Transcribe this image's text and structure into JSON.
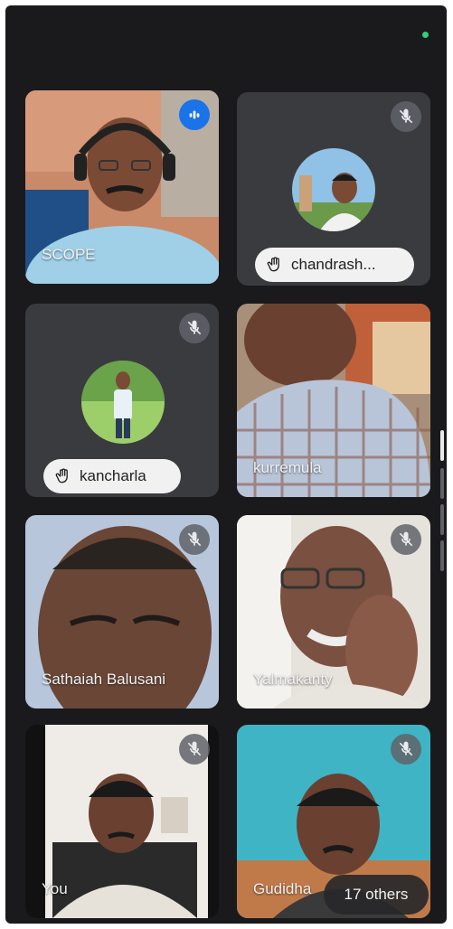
{
  "participants": [
    {
      "name": "SCOPE",
      "muted": false,
      "speaking": true
    },
    {
      "name": "chandrash...",
      "muted": true,
      "hand_raised": true
    },
    {
      "name": "kancharla",
      "muted": true,
      "hand_raised": true
    },
    {
      "name": "kurremula",
      "muted": false
    },
    {
      "name": "Sathaiah Balusani",
      "muted": true
    },
    {
      "name": "Yalmakanty",
      "muted": true
    },
    {
      "name": "You",
      "muted": true
    },
    {
      "name": "Gudidha",
      "muted": true
    }
  ],
  "others": {
    "label": "17 others"
  },
  "icons": {
    "mute": "mic-off-icon",
    "hand": "raise-hand-icon",
    "speaking": "speaking-indicator-icon"
  },
  "colors": {
    "background": "#1a1a1c",
    "tile": "#3a3b3e",
    "active_border": "#8ab4f8",
    "status_dot": "#2fd07a"
  }
}
